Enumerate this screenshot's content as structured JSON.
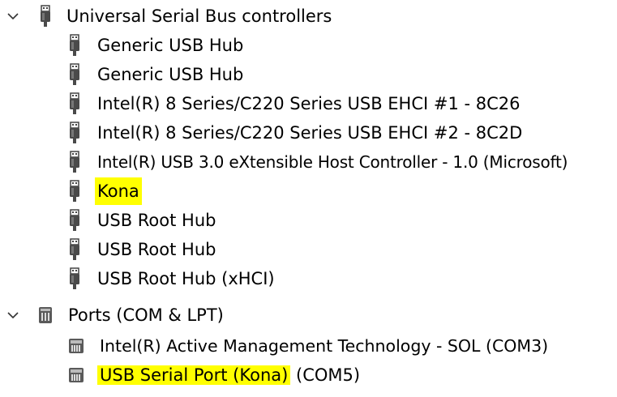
{
  "tree": {
    "categories": [
      {
        "label": "Universal Serial Bus controllers",
        "icon": "usb-connector-icon",
        "expanded": true,
        "devices": [
          {
            "label": "Generic USB Hub",
            "icon": "usb-connector-icon"
          },
          {
            "label": "Generic USB Hub",
            "icon": "usb-connector-icon"
          },
          {
            "label": "Intel(R) 8 Series/C220 Series USB EHCI #1 - 8C26",
            "icon": "usb-connector-icon"
          },
          {
            "label": "Intel(R) 8 Series/C220 Series USB EHCI #2 - 8C2D",
            "icon": "usb-connector-icon"
          },
          {
            "label": "Intel(R) USB 3.0 eXtensible Host Controller - 1.0 (Microsoft)",
            "icon": "usb-connector-icon"
          },
          {
            "label": "Kona",
            "icon": "usb-connector-icon",
            "highlighted": true
          },
          {
            "label": "USB Root Hub",
            "icon": "usb-connector-icon"
          },
          {
            "label": "USB Root Hub",
            "icon": "usb-connector-icon"
          },
          {
            "label": "USB Root Hub (xHCI)",
            "icon": "usb-connector-icon"
          }
        ]
      },
      {
        "label": "Ports (COM & LPT)",
        "icon": "port-icon",
        "expanded": true,
        "devices": [
          {
            "label": "Intel(R) Active Management Technology - SOL (COM3)",
            "icon": "serial-port-icon"
          },
          {
            "label_highlighted": "USB Serial Port (Kona)",
            "label_rest": " (COM5)",
            "icon": "serial-port-icon",
            "highlighted": true
          }
        ]
      }
    ]
  },
  "colors": {
    "highlight": "#ffff00",
    "icon_gray": "#555555"
  }
}
